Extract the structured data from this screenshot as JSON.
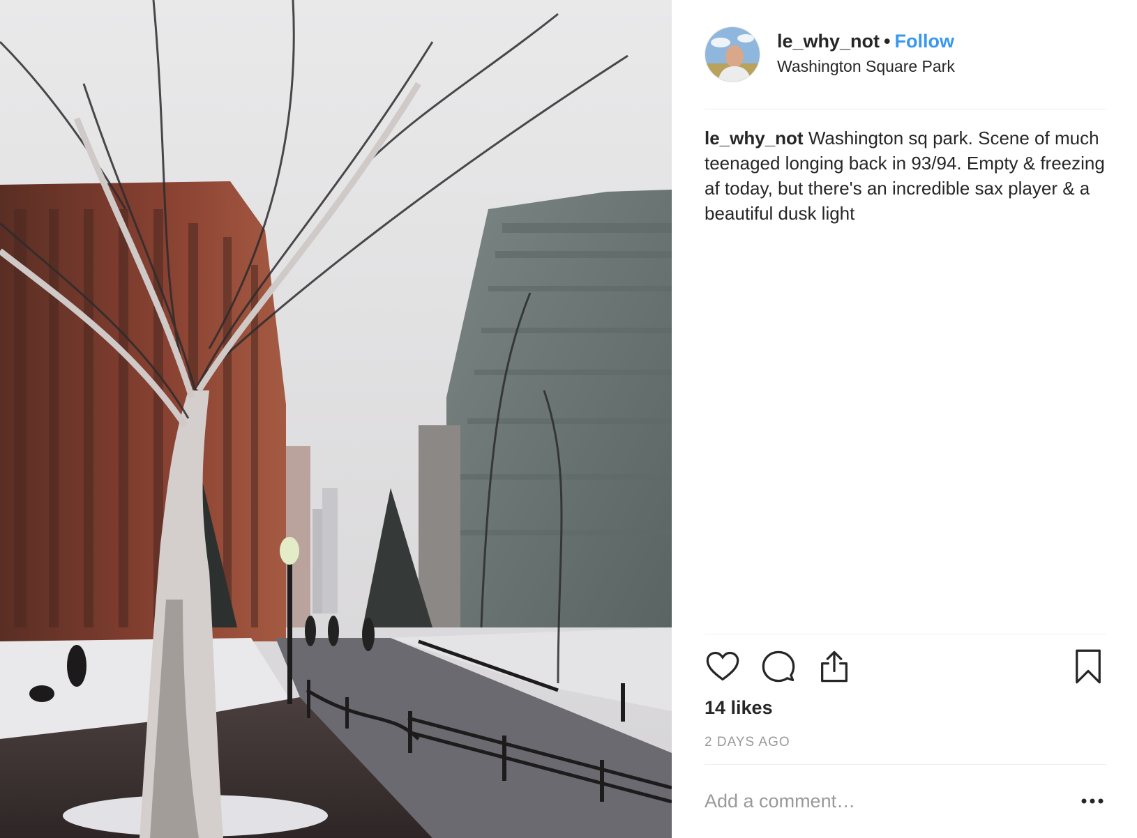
{
  "post": {
    "photo_alt": "Winter view of Washington Square Park with bare trees, snow and buildings",
    "user": {
      "username": "le_why_not",
      "separator": "•",
      "follow_label": "Follow",
      "location": "Washington Square Park"
    },
    "caption": {
      "username": "le_why_not",
      "text": "Washington sq park. Scene of much teenaged longing back in 93/94. Empty & freezing af today, but there's an incredible sax player & a beautiful dusk light"
    },
    "actions": {
      "like_icon": "heart-icon",
      "comment_icon": "comment-icon",
      "share_icon": "share-icon",
      "save_icon": "bookmark-icon"
    },
    "likes": "14 likes",
    "time_ago": "2 DAYS AGO",
    "comment": {
      "placeholder": "Add a comment…",
      "more_icon": "more-options-icon"
    }
  },
  "colors": {
    "follow": "#3897f0",
    "text": "#262626",
    "muted": "#999999",
    "divider": "#efefef"
  }
}
